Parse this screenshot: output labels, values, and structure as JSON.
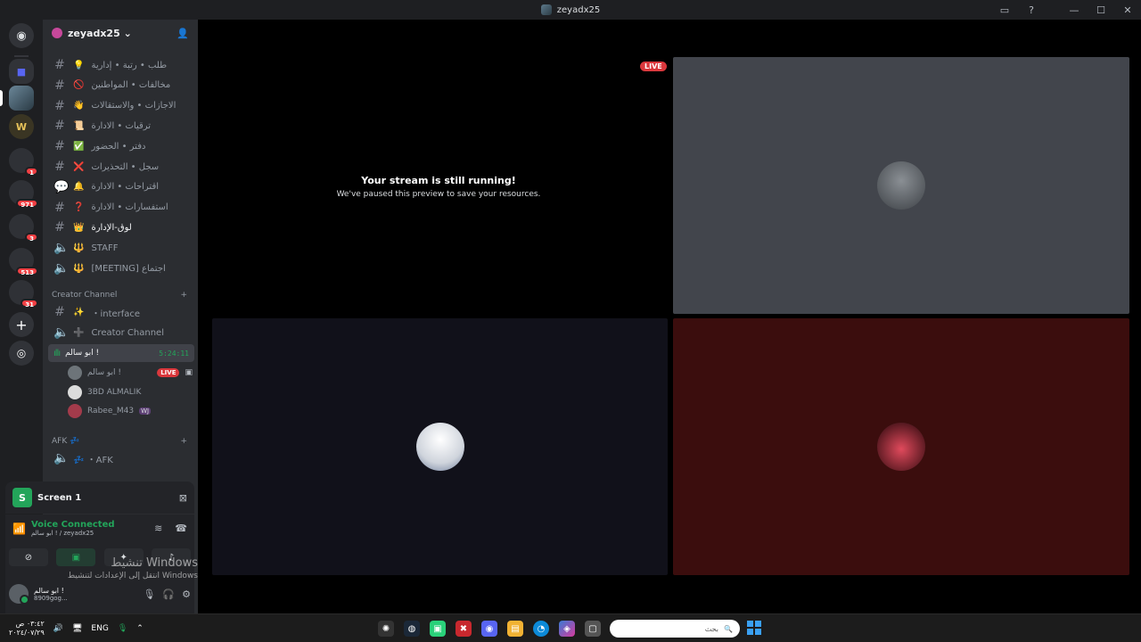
{
  "window": {
    "title": "zeyadx25",
    "controls": [
      "inbox-icon",
      "help-icon",
      "minimize",
      "maximize",
      "close"
    ]
  },
  "server": {
    "name": "zeyadx25 ⌄",
    "channels": [
      {
        "label": "طلب • رتبة • إدارية",
        "emoji": "💡",
        "type": "text"
      },
      {
        "label": "مخالفات • المواطنين",
        "emoji": "🚫",
        "type": "text"
      },
      {
        "label": "الاجازات • والاستقالات",
        "emoji": "👋",
        "type": "text"
      },
      {
        "label": "ترقيات • الادارة",
        "emoji": "📜",
        "type": "text"
      },
      {
        "label": "دفتر • الحضور",
        "emoji": "✅",
        "type": "text"
      },
      {
        "label": "سجل • التحذيرات",
        "emoji": "❌",
        "type": "text"
      },
      {
        "label": "اقتراحات • الادارة",
        "emoji": "🔔",
        "type": "forum"
      },
      {
        "label": "استفسارات • الادارة",
        "emoji": "❓",
        "type": "text"
      },
      {
        "label": "لوق-الإدارة",
        "emoji": "👑",
        "type": "text"
      },
      {
        "label": "STAFF",
        "emoji": "🔱",
        "type": "voice"
      },
      {
        "label": "[MEETING] اجتماع",
        "emoji": "🔱",
        "type": "voice"
      }
    ],
    "creator_category": "Creator Channel",
    "creator_channels": [
      {
        "label": "・interface",
        "emoji": "✨",
        "type": "text"
      },
      {
        "label": "Creator Channel",
        "emoji": "➕",
        "type": "voice"
      }
    ],
    "active_voice": {
      "name": "ابو سالم !",
      "duration": "5:24:11"
    },
    "voice_users": [
      {
        "name": "ابو سالم !",
        "live": "LIVE"
      },
      {
        "name": "3BD ALMALIK"
      },
      {
        "name": "Rabee_M43",
        "tag": "WJ"
      }
    ],
    "afk_category": "AFK 💤",
    "afk_channel": "💤 ・AFK"
  },
  "rail": {
    "badges": [
      "1",
      "971",
      "3",
      "513",
      "31"
    ]
  },
  "screen_panel": {
    "title": "Screen 1",
    "icon_letter": "S"
  },
  "voice_panel": {
    "status": "Voice Connected",
    "location": "ابو سالم ! / zeyadx25"
  },
  "user": {
    "name": "ابو سالم !",
    "tag": "8909gog..."
  },
  "stage": {
    "live_label": "LIVE",
    "stream_heading": "Your stream is still running!",
    "stream_sub": "We've paused this preview to save your resources."
  },
  "watermark": {
    "line1": "تنشيط Windows",
    "line2": "انتقل إلى الإعدادات لتنشيط Windows"
  },
  "taskbar": {
    "time": "٠٣:٤٢ ص",
    "date": "٢٠٢٤/٠٧/٢٩",
    "lang": "ENG",
    "search_placeholder": "بحث"
  },
  "colors": {
    "accent": "#5865f2",
    "green": "#23a55a",
    "red": "#da373c",
    "tile_gray": "#42454c",
    "tile_navy": "#11111a",
    "tile_maroon": "#3b0d0d"
  }
}
